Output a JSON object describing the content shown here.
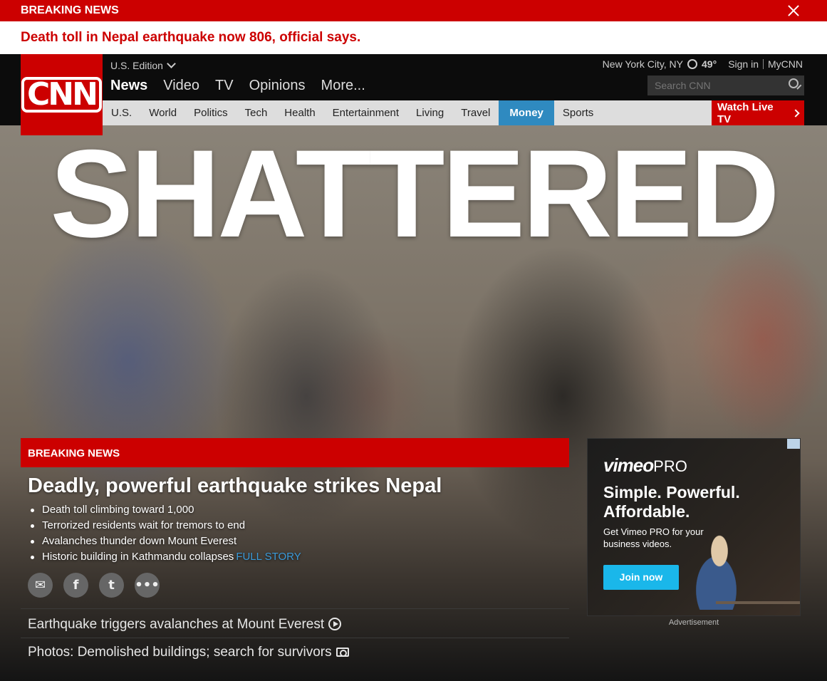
{
  "breaking_banner": {
    "label": "BREAKING NEWS",
    "headline": "Death toll in Nepal earthquake now 806, official says."
  },
  "logo": {
    "text": "CNN"
  },
  "header": {
    "edition": "U.S. Edition",
    "main_nav": [
      "News",
      "Video",
      "TV",
      "Opinions",
      "More..."
    ],
    "location": "New York City, NY",
    "temperature": "49°",
    "sign_in": "Sign in",
    "mycnn": "MyCNN",
    "search_placeholder": "Search CNN"
  },
  "subnav": {
    "items": [
      "U.S.",
      "World",
      "Politics",
      "Tech",
      "Health",
      "Entertainment",
      "Living",
      "Travel",
      "Money",
      "Sports"
    ],
    "active": "Money",
    "watch_live": "Watch Live TV"
  },
  "hero": {
    "big_word": "SHATTERED",
    "breaking_label": "BREAKING NEWS",
    "title": "Deadly, powerful earthquake strikes Nepal",
    "bullets": [
      "Death toll climbing toward 1,000",
      "Terrorized residents wait for tremors to end",
      "Avalanches thunder down Mount Everest",
      "Historic building in Kathmandu collapses"
    ],
    "full_story": "FULL STORY",
    "share_icons": [
      "email-icon",
      "facebook-icon",
      "twitter-icon",
      "more-icon"
    ],
    "related": [
      {
        "text": "Earthquake triggers avalanches at Mount Everest",
        "icon": "play-icon"
      },
      {
        "text": "Photos: Demolished buildings; search for survivors",
        "icon": "camera-icon"
      }
    ]
  },
  "ad": {
    "brand": "vimeo",
    "brand_suffix": "PRO",
    "headline": "Simple. Powerful. Affordable.",
    "subtext": "Get Vimeo PRO for your business videos.",
    "button": "Join now",
    "label": "Advertisement"
  },
  "colors": {
    "cnn_red": "#cc0000",
    "money_blue": "#2f8ac0",
    "vimeo_blue": "#1ab7ea",
    "link_blue": "#3a9ad9"
  }
}
